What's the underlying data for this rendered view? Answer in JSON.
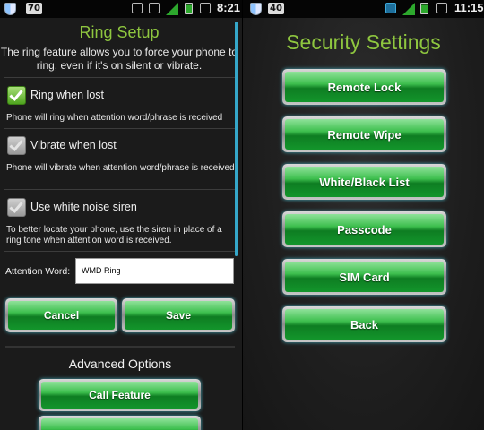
{
  "left": {
    "status": {
      "badge": "70",
      "time": "8:21"
    },
    "title": "Ring Setup",
    "intro": "The ring feature allows you to force your phone to ring, even if it's on silent or vibrate.",
    "options": [
      {
        "label": "Ring when lost",
        "checked": true,
        "desc": "Phone will ring when attention word/phrase is received"
      },
      {
        "label": "Vibrate when lost",
        "checked": false,
        "desc": "Phone will vibrate when attention word/phrase is received"
      },
      {
        "label": "Use white noise siren",
        "checked": false,
        "desc": "To better locate your phone, use the siren in place of a ring tone when attention word is received."
      }
    ],
    "attention": {
      "label": "Attention Word:",
      "value": "WMD Ring"
    },
    "buttons": {
      "cancel": "Cancel",
      "save": "Save"
    },
    "advanced": {
      "title": "Advanced Options",
      "call_feature": "Call Feature"
    }
  },
  "right": {
    "status": {
      "badge": "40",
      "time": "11:15"
    },
    "title": "Security Settings",
    "buttons": [
      "Remote Lock",
      "Remote Wipe",
      "White/Black List",
      "Passcode",
      "SIM Card",
      "Back"
    ]
  },
  "colors": {
    "accent_green": "#8ec63f",
    "button_glow": "#35a7c9",
    "scroll": "#35a7c9"
  }
}
